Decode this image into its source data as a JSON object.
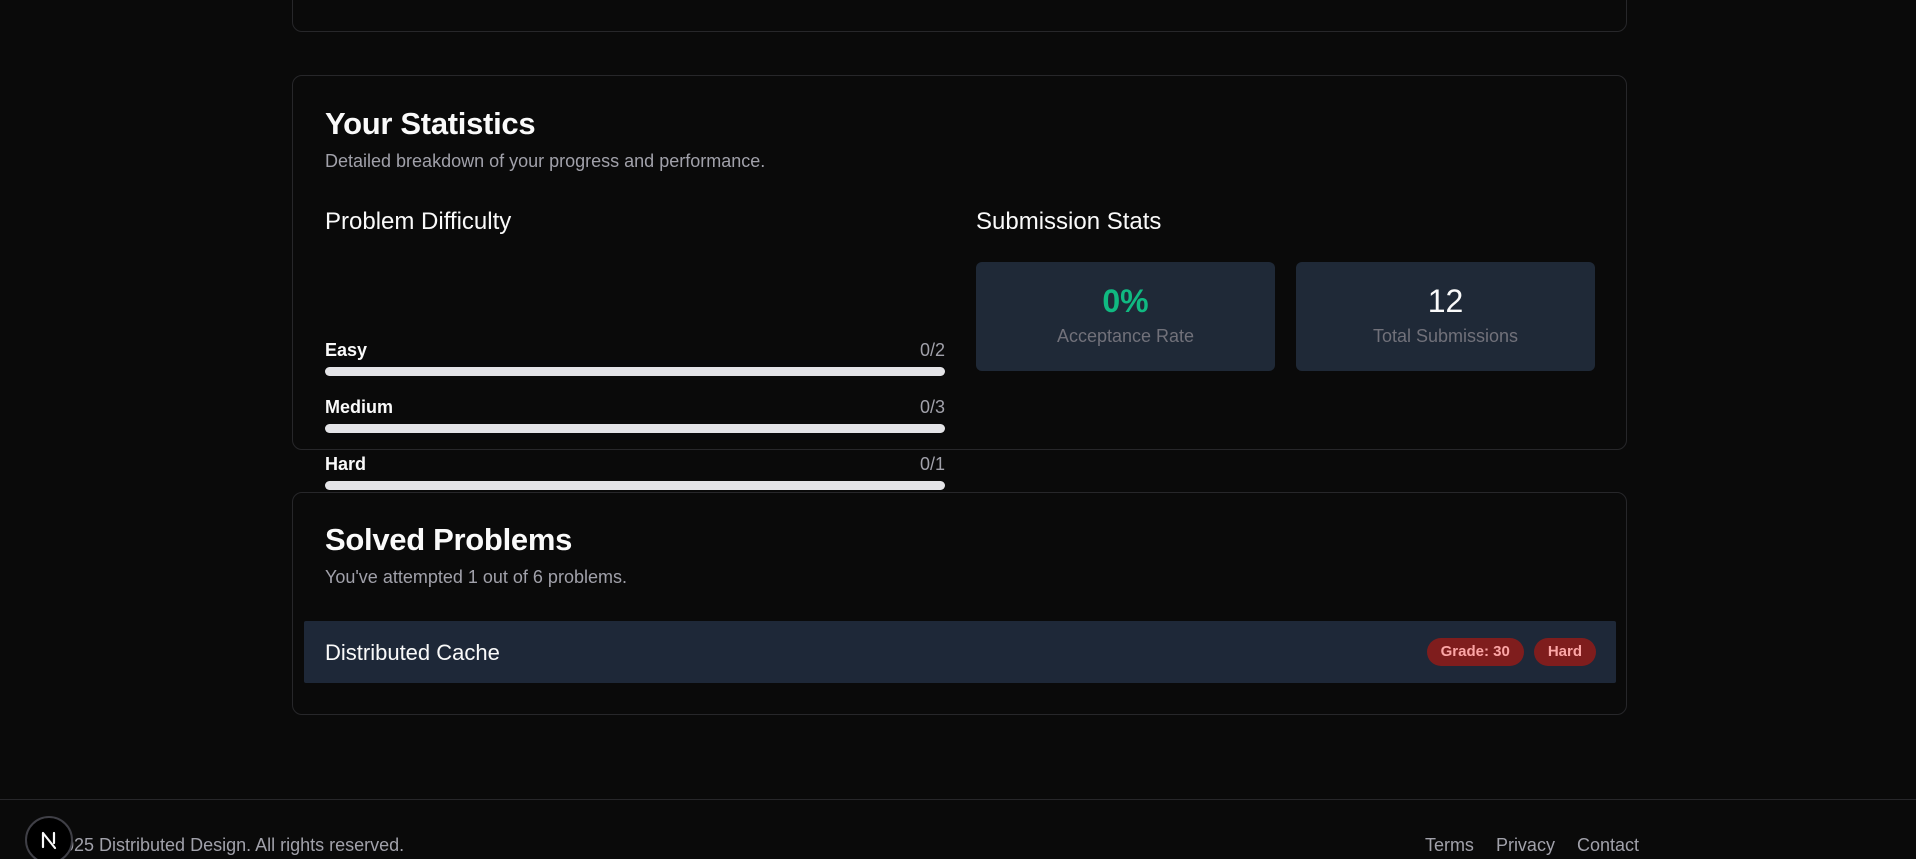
{
  "stats": {
    "title": "Your Statistics",
    "description": "Detailed breakdown of your progress and performance.",
    "difficulty": {
      "title": "Problem Difficulty",
      "levels": [
        {
          "label": "Easy",
          "count": "0/2",
          "solved": 0,
          "total": 2
        },
        {
          "label": "Medium",
          "count": "0/3",
          "solved": 0,
          "total": 3
        },
        {
          "label": "Hard",
          "count": "0/1",
          "solved": 0,
          "total": 1
        }
      ],
      "bar_track_color": "#e4e4e7",
      "bar_fill_color": "#22c55e"
    },
    "submissions": {
      "title": "Submission Stats",
      "acceptance": {
        "value": "0%",
        "label": "Acceptance Rate",
        "color": "#10b981"
      },
      "total": {
        "value": "12",
        "label": "Total Submissions"
      }
    }
  },
  "solved": {
    "title": "Solved Problems",
    "description": "You've attempted 1 out of 6 problems.",
    "problems": [
      {
        "title": "Distributed Cache",
        "grade": "Grade: 30",
        "difficulty": "Hard"
      }
    ],
    "badge_color": "#7f1d1d"
  },
  "footer": {
    "copyright": "025 Distributed Design. All rights reserved.",
    "links": [
      "Terms",
      "Privacy",
      "Contact"
    ]
  },
  "next_badge": {
    "letter": "N",
    "icon": "nextjs-icon"
  }
}
